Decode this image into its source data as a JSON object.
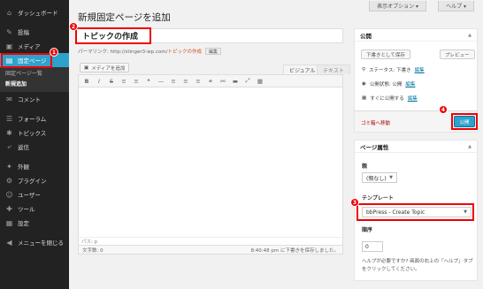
{
  "sidebar": {
    "items": [
      {
        "label": "ダッシュボード",
        "icon": "⌂"
      },
      {
        "label": "投稿",
        "icon": "✎"
      },
      {
        "label": "メディア",
        "icon": "▣"
      },
      {
        "label": "固定ページ",
        "icon": "▤"
      },
      {
        "label": "コメント",
        "icon": "✉"
      },
      {
        "label": "フォーラム",
        "icon": "☰"
      },
      {
        "label": "トピックス",
        "icon": "✱"
      },
      {
        "label": "返信",
        "icon": "⤶"
      },
      {
        "label": "外観",
        "icon": "✦"
      },
      {
        "label": "プラグイン",
        "icon": "⚙"
      },
      {
        "label": "ユーザー",
        "icon": "☺"
      },
      {
        "label": "ツール",
        "icon": "✚"
      },
      {
        "label": "設定",
        "icon": "▦"
      },
      {
        "label": "メニューを閉じる",
        "icon": "◀"
      }
    ],
    "sub_items": [
      "固定ページ一覧",
      "新規追加"
    ]
  },
  "header": {
    "screen_options": "表示オプション ▾",
    "help": "ヘルプ ▾",
    "page_title": "新規固定ページを追加"
  },
  "editor": {
    "title_value": "トピックの作成",
    "permalink_label": "パーマリンク: http://stinger3-wp.com/",
    "permalink_slug": "トピックの作成",
    "permalink_edit": "編集",
    "media_button": "メディアを追加",
    "tab_visual": "ビジュアル",
    "tab_text": "テキスト",
    "toolbar_icons": [
      "B",
      "I",
      "S",
      "≡",
      "≡",
      "❝",
      "—",
      "≡",
      "≡",
      "≡",
      "⚭",
      "⚯",
      "▬",
      "⤢",
      "▦"
    ],
    "path": "パス: p",
    "word_count": "文字数: 0",
    "draft_saved": "8:40:48 pm に下書きを保存しました。"
  },
  "publish_box": {
    "title": "公開",
    "save_draft": "下書きとして保存",
    "preview": "プレビュー",
    "status_label": "ステータス: 下書き",
    "status_edit": "編集",
    "visibility_label": "公開状態: 公開",
    "visibility_edit": "編集",
    "schedule_label": "すぐに公開する",
    "schedule_edit": "編集",
    "trash": "ゴミ箱へ移動",
    "publish": "公開"
  },
  "attributes_box": {
    "title": "ページ属性",
    "parent_label": "親",
    "parent_value": "(親なし)",
    "template_label": "テンプレート",
    "template_value": "bbPress - Create Topic",
    "order_label": "順序",
    "order_value": "0",
    "help_text": "ヘルプが必要ですか? 画面の右上の「ヘルプ」タブをクリックしてください。"
  },
  "annotations": [
    "1",
    "2",
    "3",
    "4"
  ],
  "colors": {
    "accent": "#2ea2cc",
    "highlight": "#e00000",
    "sidebar_bg": "#222222"
  }
}
